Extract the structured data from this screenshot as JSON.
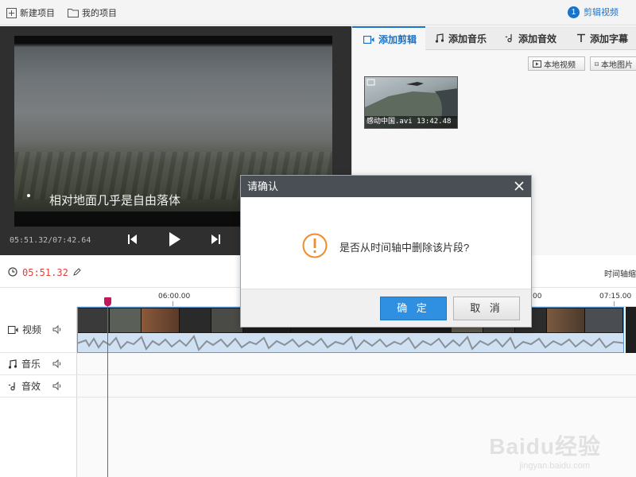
{
  "toolbar": {
    "new_project": "新建项目",
    "my_projects": "我的项目",
    "step_number": "1",
    "step_label": "剪辑视频"
  },
  "player": {
    "subtitle": "相对地面几乎是自由落体",
    "time": "05:51.32/07:42.64"
  },
  "right_panel": {
    "tabs": [
      {
        "label": "添加剪辑",
        "icon": "video-camera-icon",
        "active": true
      },
      {
        "label": "添加音乐",
        "icon": "music-note-icon",
        "active": false
      },
      {
        "label": "添加音效",
        "icon": "sound-effect-icon",
        "active": false
      },
      {
        "label": "添加字幕",
        "icon": "text-t-icon",
        "active": false
      }
    ],
    "local_video": "本地视频",
    "local_image": "本地图片",
    "thumbnail_caption": "感动中国.avi 13:42.48"
  },
  "timeline": {
    "current_time": "05:51.32",
    "zoom_label": "时间轴缩",
    "ruler_ticks": [
      "06:00.00",
      ":00",
      "07:15.00"
    ],
    "tracks": [
      {
        "label": "视频",
        "icon": "video-track-icon"
      },
      {
        "label": "音乐",
        "icon": "music-track-icon"
      },
      {
        "label": "音效",
        "icon": "sound-effect-track-icon"
      }
    ]
  },
  "dialog": {
    "title": "请确认",
    "message": "是否从时间轴中删除该片段?",
    "ok": "确 定",
    "cancel": "取 消"
  },
  "watermark": {
    "logo": "Baidu经验",
    "url": "jingyan.baidu.com"
  },
  "colors": {
    "accent": "#1a73c8",
    "time_red": "#e0403a",
    "warning_orange": "#f08c2a",
    "playhead": "#d6336c",
    "dialog_header": "#4a4f55"
  }
}
